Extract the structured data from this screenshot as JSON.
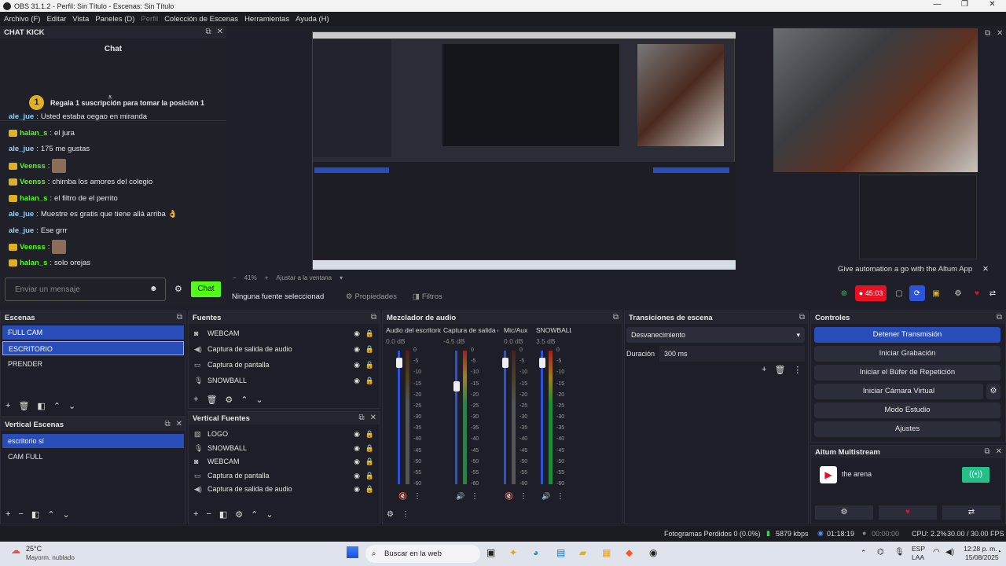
{
  "window": {
    "title": "OBS 31.1.2 - Perfil: Sin Título - Escenas: Sin Título"
  },
  "menu": [
    "Archivo (F)",
    "Editar",
    "Vista",
    "Paneles (D)",
    "Perfil",
    "Colección de Escenas",
    "Herramientas",
    "Ayuda (H)"
  ],
  "chat": {
    "dock_title": "CHAT KICK",
    "title": "Chat",
    "gift_number": "1",
    "gift_text": "Regala 1 suscripción para tomar la posición 1",
    "messages": [
      {
        "user": "ale_jue",
        "text": "Usted estaba oegao en miranda"
      },
      {
        "user": "halan_s",
        "text": "el jura"
      },
      {
        "user": "ale_jue",
        "text": "175 me gustas"
      },
      {
        "user": "Veenss",
        "text": ""
      },
      {
        "user": "Veenss",
        "text": "chimba los amores del colegio"
      },
      {
        "user": "halan_s",
        "text": "el filtro de el perrito"
      },
      {
        "user": "ale_jue",
        "text": "Muestre es gratis que tiene allá arriba 👌"
      },
      {
        "user": "ale_jue",
        "text": "Ese grrr"
      },
      {
        "user": "Veenss",
        "text": ""
      },
      {
        "user": "halan_s",
        "text": "solo orejas"
      }
    ],
    "input_placeholder": "Enviar un mensaje",
    "send_label": "Chat"
  },
  "preview": {
    "zoom": "41%",
    "fit_label": "Ajustar a la ventana",
    "no_source": "Ninguna fuente seleccionad",
    "properties": "Propiedades",
    "filters": "Filtros"
  },
  "altum_banner": {
    "text": "Give automation a go with the Altum App",
    "timer": "45:03"
  },
  "scenes": {
    "title": "Escenas",
    "items": [
      "FULL CAM",
      "ESCRITORIO",
      "PRENDER"
    ]
  },
  "vertical_scenes": {
    "title": "Vertical Escenas",
    "items": [
      "escritorio sí",
      "CAM FULL"
    ]
  },
  "sources": {
    "title": "Fuentes",
    "items": [
      "WEBCAM",
      "Captura de salida de audio",
      "Captura de pantalla",
      "SNOWBALL"
    ]
  },
  "vertical_sources": {
    "title": "Vertical Fuentes",
    "items": [
      "LOGO",
      "SNOWBALL",
      "WEBCAM",
      "Captura de pantalla",
      "Captura de salida de audio"
    ]
  },
  "mixer": {
    "title": "Mezclador de audio",
    "channels": [
      {
        "name": "Audio del escritorio",
        "db": "0.0 dB",
        "volume": 0.95,
        "muted": true
      },
      {
        "name": "Captura de salida d",
        "db": "-4.5 dB",
        "volume": 0.77,
        "muted": false
      },
      {
        "name": "Mic/Aux",
        "db": "0.0 dB",
        "volume": 0.95,
        "muted": true
      },
      {
        "name": "SNOWBALL",
        "db": "3.5 dB",
        "volume": 0.95,
        "muted": false
      }
    ],
    "scale": [
      "0",
      "-5",
      "-10",
      "-15",
      "-20",
      "-25",
      "-30",
      "-35",
      "-40",
      "-45",
      "-50",
      "-55",
      "-60"
    ]
  },
  "transitions": {
    "title": "Transiciones de escena",
    "selected": "Desvanecimiento",
    "duration_label": "Duración",
    "duration_value": "300 ms"
  },
  "controls": {
    "title": "Controles",
    "buttons": [
      "Detener Transmisión",
      "Iniciar Grabación",
      "Iniciar el Búfer de Repetición",
      "Iniciar Cámara Virtual",
      "Modo Estudio",
      "Ajustes"
    ]
  },
  "altum": {
    "title": "Aitum Multistream",
    "stream_name": "the arena"
  },
  "status": {
    "dropped": "Fotogramas Perdidos 0 (0.0%)",
    "bitrate": "5879 kbps",
    "live_time": "01:18:19",
    "rec_time": "00:00:00",
    "cpu": "CPU: 2.2%",
    "fps": "30.00 / 30.00 FPS"
  },
  "taskbar": {
    "temp": "25°C",
    "weather": "Mayorm. nublado",
    "search": "Buscar en la web",
    "lang": "ESP",
    "lang2": "LAA",
    "time": "12:28 p. m.",
    "date": "15/08/2025"
  },
  "colors": {
    "accent": "#284cb8",
    "kick_green": "#53fc18",
    "live_red": "#e81123"
  }
}
